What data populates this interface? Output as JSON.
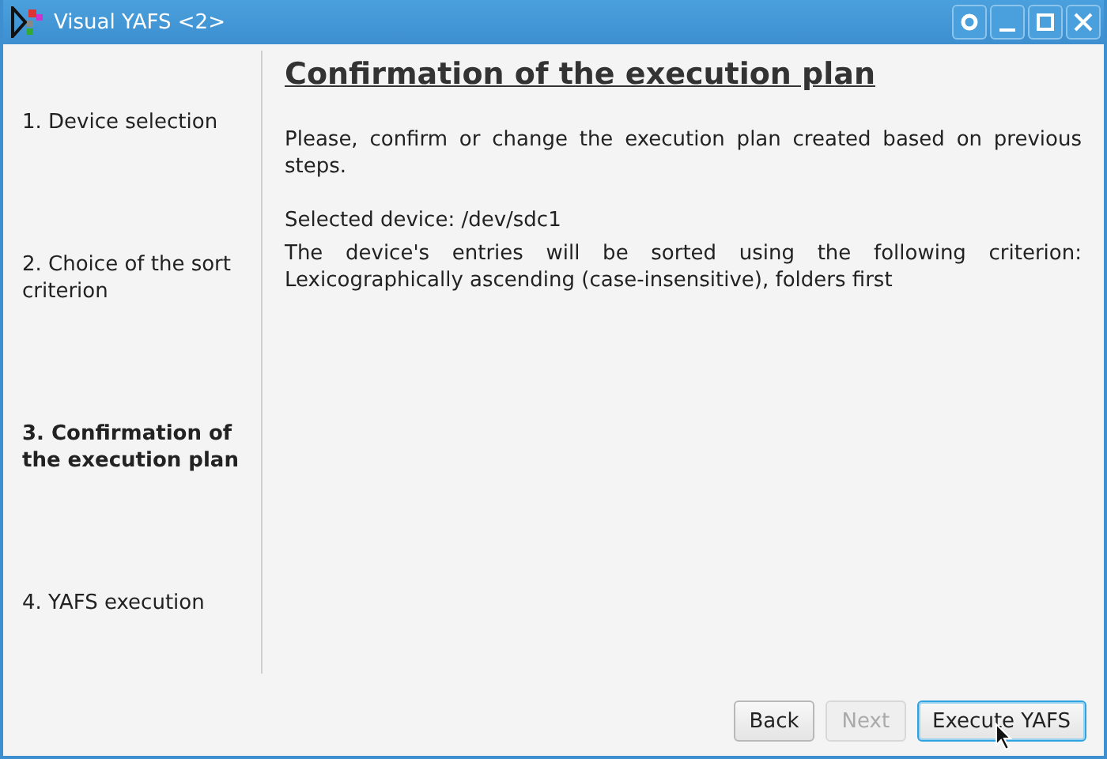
{
  "window": {
    "title": "Visual YAFS <2>"
  },
  "steps": [
    {
      "label": "1. Device selection",
      "selected": false
    },
    {
      "label": "2. Choice of the sort criterion",
      "selected": false
    },
    {
      "label": "3. Confirmation of the execution plan",
      "selected": true
    },
    {
      "label": "4. YAFS execution",
      "selected": false
    }
  ],
  "content": {
    "heading": "Confirmation of the execution plan",
    "intro": "Please, confirm or change the execution plan created based on previous steps.",
    "device": "Selected device: /dev/sdc1",
    "criterion": "The device's entries will be sorted using the following criterion: Lexicographically ascending (case-insensitive), folders first"
  },
  "buttons": [
    {
      "label": "Back",
      "disabled": false,
      "focused": false
    },
    {
      "label": "Next",
      "disabled": true,
      "focused": false
    },
    {
      "label": "Execute YAFS",
      "disabled": false,
      "focused": true
    }
  ]
}
